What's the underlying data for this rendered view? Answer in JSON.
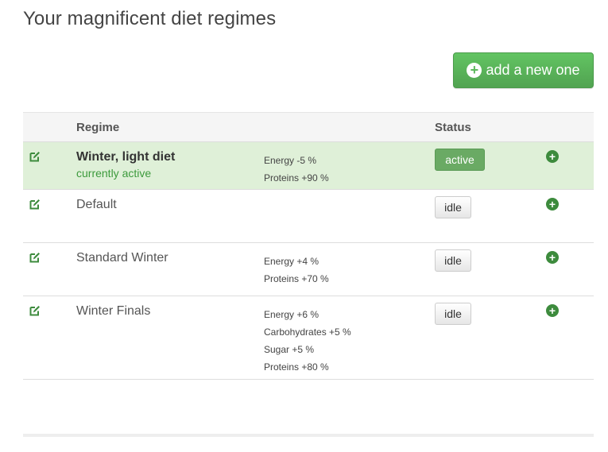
{
  "page": {
    "title": "Your magnificent diet regimes"
  },
  "add_button": {
    "label": "add a new one",
    "icon": "plus-circle-icon"
  },
  "table": {
    "headers": {
      "regime": "Regime",
      "status": "Status"
    },
    "rows": [
      {
        "name": "Winter, light diet",
        "note": "currently active",
        "details": [
          "Energy -5 %",
          "Proteins +90 %"
        ],
        "status": "active"
      },
      {
        "name": "Default",
        "note": "",
        "details": [],
        "status": "idle"
      },
      {
        "name": "Standard Winter",
        "note": "",
        "details": [
          "Energy +4 %",
          "Proteins +70 %"
        ],
        "status": "idle"
      },
      {
        "name": "Winter Finals",
        "note": "",
        "details": [
          "Energy +6 %",
          "Carbohydrates +5 %",
          "Sugar +5 %",
          "Proteins +80 %"
        ],
        "status": "idle"
      }
    ]
  },
  "colors": {
    "accent": "#5cb85c",
    "active_row": "#dff0d8",
    "active_text": "#3c9a3c",
    "icon_green": "#3d8b3d"
  }
}
